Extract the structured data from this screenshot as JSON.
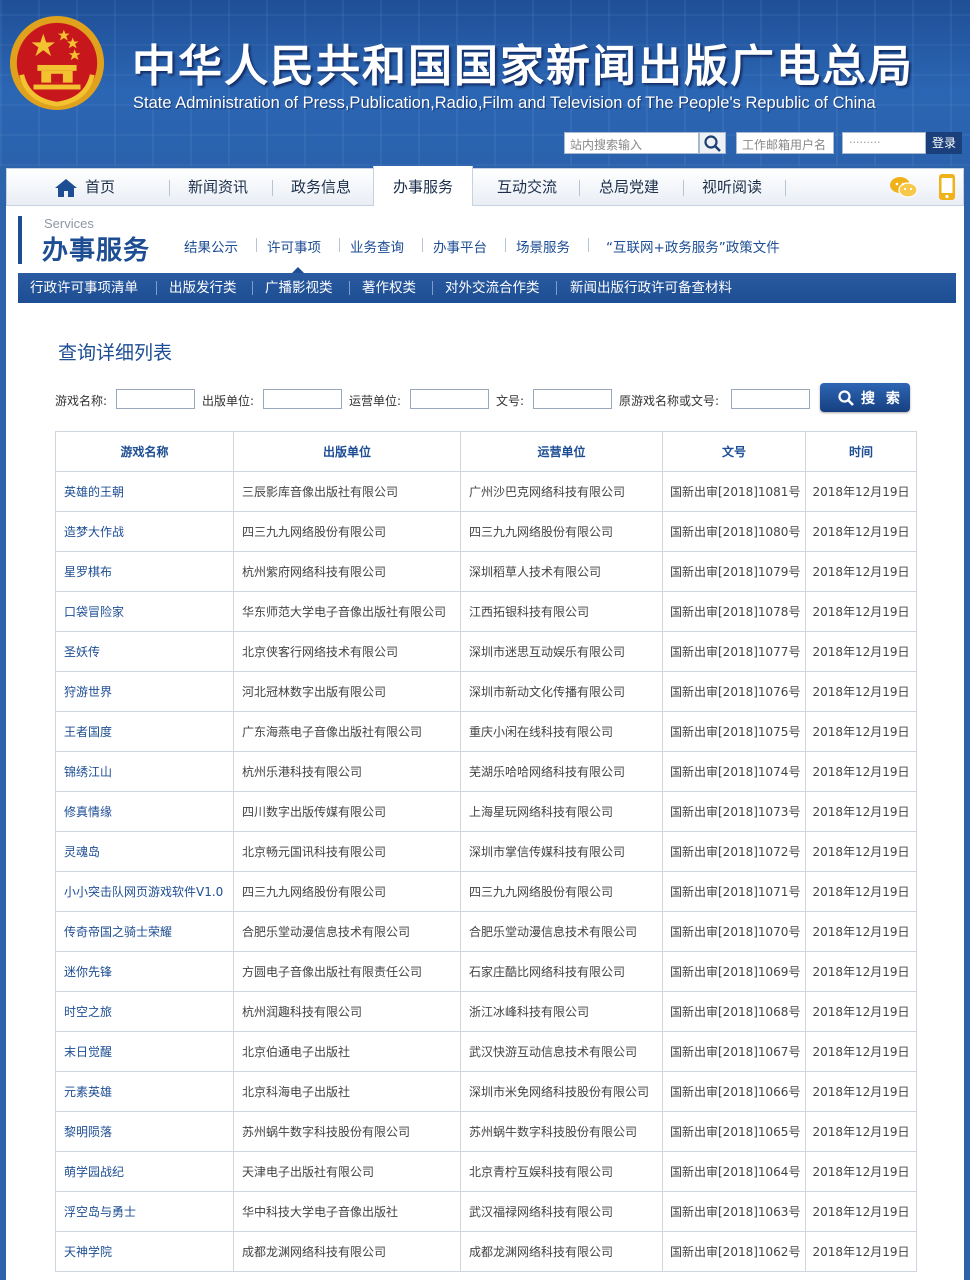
{
  "header": {
    "title": "中华人民共和国国家新闻出版广电总局",
    "subtitle": "State Administration of Press,Publication,Radio,Film and Television of The People's Republic of China",
    "search_placeholder": "站内搜索输入",
    "mail_placeholder": "工作邮箱用户名",
    "password_placeholder": "·········",
    "login_label": "登录"
  },
  "nav": {
    "items": [
      "首页",
      "新闻资讯",
      "政务信息",
      "办事服务",
      "互动交流",
      "总局党建",
      "视听阅读"
    ],
    "active": "办事服务"
  },
  "section": {
    "en": "Services",
    "cn": "办事服务",
    "links": [
      "结果公示",
      "许可事项",
      "业务查询",
      "办事平台",
      "场景服务",
      "“互联网+政务服务”政策文件"
    ],
    "active_link": "许可事项"
  },
  "categories": [
    "行政许可事项清单",
    "出版发行类",
    "广播影视类",
    "著作权类",
    "对外交流合作类",
    "新闻出版行政许可备查材料"
  ],
  "list_title": "查询详细列表",
  "filters": {
    "labels": [
      "游戏名称:",
      "出版单位:",
      "运营单位:",
      "文号:",
      "原游戏名称或文号:"
    ],
    "submit_label": "搜 索"
  },
  "table": {
    "headers": [
      "游戏名称",
      "出版单位",
      "运营单位",
      "文号",
      "时间"
    ],
    "rows": [
      [
        "英雄的王朝",
        "三辰影库音像出版社有限公司",
        "广州沙巴克网络科技有限公司",
        "国新出审[2018]1081号",
        "2018年12月19日"
      ],
      [
        "造梦大作战",
        "四三九九网络股份有限公司",
        "四三九九网络股份有限公司",
        "国新出审[2018]1080号",
        "2018年12月19日"
      ],
      [
        "星罗棋布",
        "杭州紫府网络科技有限公司",
        "深圳稻草人技术有限公司",
        "国新出审[2018]1079号",
        "2018年12月19日"
      ],
      [
        "口袋冒险家",
        "华东师范大学电子音像出版社有限公司",
        "江西拓银科技有限公司",
        "国新出审[2018]1078号",
        "2018年12月19日"
      ],
      [
        "圣妖传",
        "北京侠客行网络技术有限公司",
        "深圳市迷思互动娱乐有限公司",
        "国新出审[2018]1077号",
        "2018年12月19日"
      ],
      [
        "狩游世界",
        "河北冠林数字出版有限公司",
        "深圳市新动文化传播有限公司",
        "国新出审[2018]1076号",
        "2018年12月19日"
      ],
      [
        "王者国度",
        "广东海燕电子音像出版社有限公司",
        "重庆小闲在线科技有限公司",
        "国新出审[2018]1075号",
        "2018年12月19日"
      ],
      [
        "锦绣江山",
        "杭州乐港科技有限公司",
        "芜湖乐哈哈网络科技有限公司",
        "国新出审[2018]1074号",
        "2018年12月19日"
      ],
      [
        "修真情缘",
        "四川数字出版传媒有限公司",
        "上海星玩网络科技有限公司",
        "国新出审[2018]1073号",
        "2018年12月19日"
      ],
      [
        "灵魂岛",
        "北京畅元国讯科技有限公司",
        "深圳市掌信传媒科技有限公司",
        "国新出审[2018]1072号",
        "2018年12月19日"
      ],
      [
        "小小突击队网页游戏软件V1.0",
        "四三九九网络股份有限公司",
        "四三九九网络股份有限公司",
        "国新出审[2018]1071号",
        "2018年12月19日"
      ],
      [
        "传奇帝国之骑士荣耀",
        "合肥乐堂动漫信息技术有限公司",
        "合肥乐堂动漫信息技术有限公司",
        "国新出审[2018]1070号",
        "2018年12月19日"
      ],
      [
        "迷你先锋",
        "方圆电子音像出版社有限责任公司",
        "石家庄酷比网络科技有限公司",
        "国新出审[2018]1069号",
        "2018年12月19日"
      ],
      [
        "时空之旅",
        "杭州润趣科技有限公司",
        "浙江冰峰科技有限公司",
        "国新出审[2018]1068号",
        "2018年12月19日"
      ],
      [
        "末日觉醒",
        "北京伯通电子出版社",
        "武汉快游互动信息技术有限公司",
        "国新出审[2018]1067号",
        "2018年12月19日"
      ],
      [
        "元素英雄",
        "北京科海电子出版社",
        "深圳市米免网络科技股份有限公司",
        "国新出审[2018]1066号",
        "2018年12月19日"
      ],
      [
        "黎明陨落",
        "苏州蜗牛数字科技股份有限公司",
        "苏州蜗牛数字科技股份有限公司",
        "国新出审[2018]1065号",
        "2018年12月19日"
      ],
      [
        "萌学园战纪",
        "天津电子出版社有限公司",
        "北京青柠互娱科技有限公司",
        "国新出审[2018]1064号",
        "2018年12月19日"
      ],
      [
        "浮空岛与勇士",
        "华中科技大学电子音像出版社",
        "武汉福禄网络科技有限公司",
        "国新出审[2018]1063号",
        "2018年12月19日"
      ],
      [
        "天神学院",
        "成都龙渊网络科技有限公司",
        "成都龙渊网络科技有限公司",
        "国新出审[2018]1062号",
        "2018年12月19日"
      ]
    ]
  },
  "icons": [
    "national-emblem-icon",
    "search-icon",
    "home-icon",
    "wechat-icon",
    "mobile-icon"
  ],
  "colors": {
    "brand_blue": "#1d4d93",
    "header_blue": "#2b66b4",
    "border": "#cfd6df",
    "emblem_red": "#c8161d",
    "emblem_gold": "#f2c230"
  }
}
